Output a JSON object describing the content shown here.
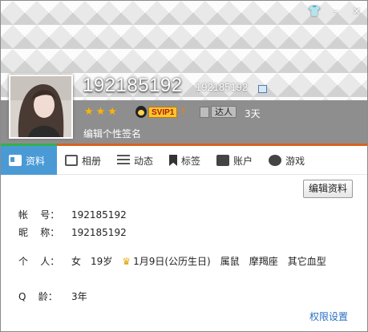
{
  "window": {
    "controls": {
      "skin": "👕",
      "minimize": "–",
      "close": "×"
    }
  },
  "profile": {
    "nickname_display": "192185192",
    "qq_number_display": "192185192",
    "stars": "★★★",
    "vip_label": "SVIP1",
    "vip_up": "↑",
    "daren_label": "达人",
    "days": "3天",
    "signature": "编辑个性签名"
  },
  "tabs": [
    {
      "label": "资料",
      "icon": "profile-card-icon",
      "active": true
    },
    {
      "label": "相册",
      "icon": "photo-album-icon"
    },
    {
      "label": "动态",
      "icon": "feed-list-icon"
    },
    {
      "label": "标签",
      "icon": "tag-icon"
    },
    {
      "label": "账户",
      "icon": "wallet-icon"
    },
    {
      "label": "游戏",
      "icon": "game-icon"
    }
  ],
  "edit_button": "编辑资料",
  "info": {
    "account_label": "帐    号：",
    "account_value": "192185192",
    "nick_label": "昵    称：",
    "nick_value": "192185192",
    "person_label": "个    人：",
    "gender": "女",
    "age": "19岁",
    "birthday": "1月9日(公历生日)",
    "zodiac": "属鼠",
    "constellation": "摩羯座",
    "blood_type": "其它血型",
    "qage_label": "Q    龄：",
    "qage_value": "3年"
  },
  "permission_link": "权限设置",
  "colors": {
    "accent": "#4a9ad6",
    "orange_line": "#d9611f",
    "link": "#2a6fc2"
  }
}
